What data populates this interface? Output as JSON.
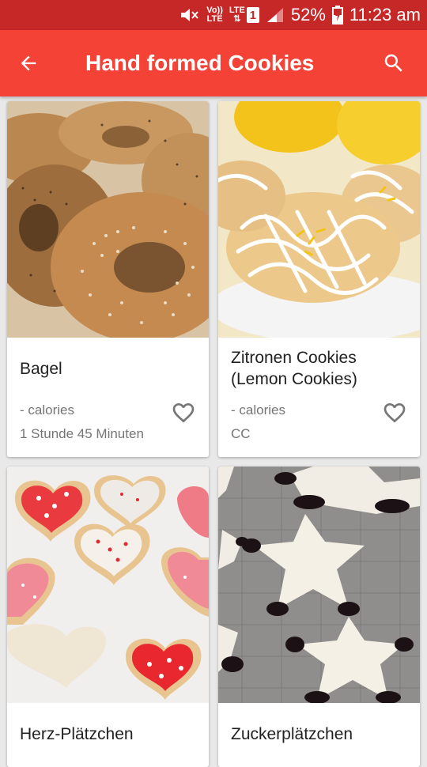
{
  "status_bar": {
    "volte_top": "Vo))",
    "volte_bottom": "LTE",
    "lte_top": "LTE",
    "lte_bottom": "⇅",
    "sim_slot": "1",
    "battery_percent": "52%",
    "time": "11:23 am"
  },
  "app_bar": {
    "title": "Hand formed Cookies",
    "back_icon": "arrow-back-icon",
    "search_icon": "search-icon"
  },
  "recipes": [
    {
      "name": "Bagel",
      "calories": "- calories",
      "detail": "1 Stunde 45 Minuten",
      "image": "bagel-photo",
      "favorite": false
    },
    {
      "name": "Zitronen Cookies (Lemon Cookies)",
      "calories": "- calories",
      "detail": "CC",
      "image": "lemon-cookies-photo",
      "favorite": false
    },
    {
      "name": "Herz-Plätzchen",
      "image": "heart-cookies-photo"
    },
    {
      "name": "Zuckerplätzchen",
      "image": "star-cookies-photo"
    }
  ],
  "colors": {
    "status_bar": "#c62828",
    "app_bar": "#f44336",
    "background": "#e9e9e9"
  }
}
